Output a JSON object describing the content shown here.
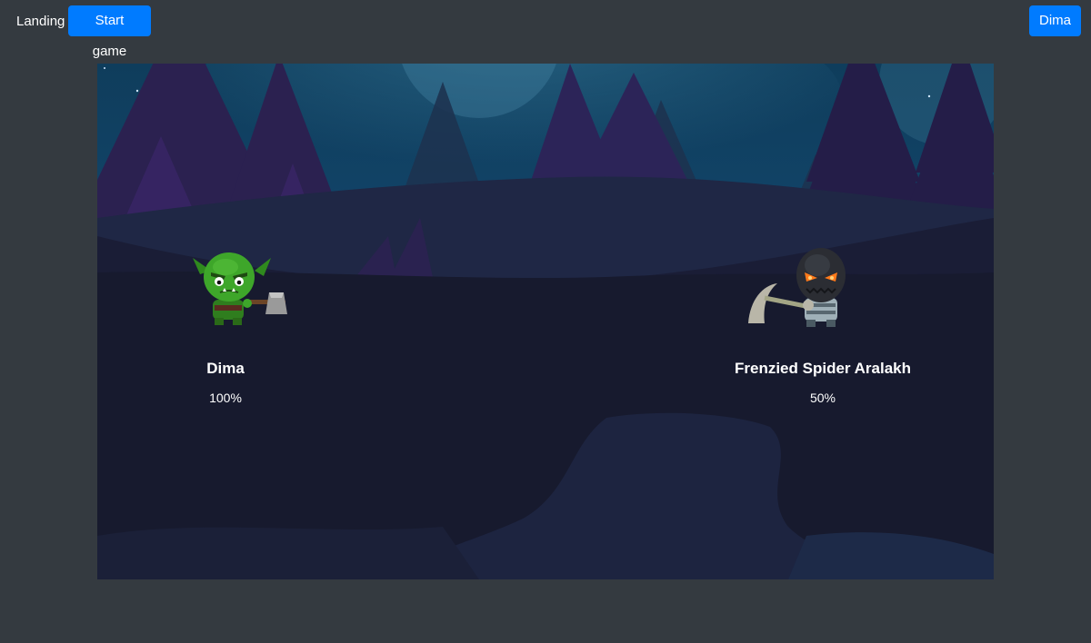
{
  "header": {
    "brand": "Landing",
    "start_button": "Start game",
    "user_button": "Dima"
  },
  "colors": {
    "page_background": "#343a40",
    "button_primary": "#007bff",
    "arena_night": "#171a2e"
  },
  "player": {
    "name": "Dima",
    "health": "100%",
    "sprite": "green-orc-with-axe"
  },
  "enemy": {
    "name": "Frenzied Spider Aralakh",
    "health": "50%",
    "sprite": "dark-golem-with-scythe"
  }
}
